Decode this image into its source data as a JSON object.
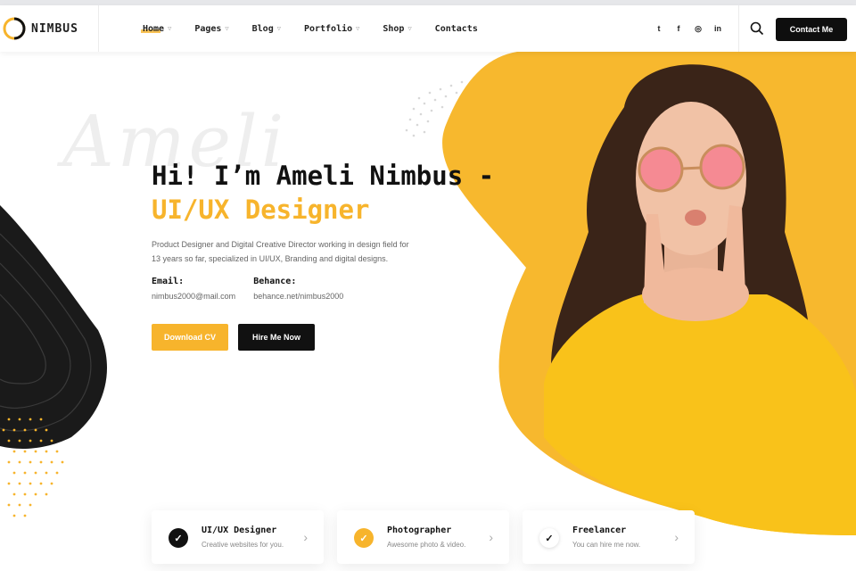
{
  "brand": {
    "name": "NIMBUS"
  },
  "nav": [
    {
      "label": "Home",
      "active": true
    },
    {
      "label": "Pages",
      "active": false
    },
    {
      "label": "Blog",
      "active": false
    },
    {
      "label": "Portfolio",
      "active": false
    },
    {
      "label": "Shop",
      "active": false
    },
    {
      "label": "Contacts",
      "active": false
    }
  ],
  "social": [
    {
      "icon": "twitter-icon",
      "glyph": "t"
    },
    {
      "icon": "facebook-icon",
      "glyph": "f"
    },
    {
      "icon": "instagram-icon",
      "glyph": "◎"
    },
    {
      "icon": "linkedin-icon",
      "glyph": "in"
    }
  ],
  "header": {
    "contact_label": "Contact Me"
  },
  "hero": {
    "watermark": "Ameli",
    "title_line1": "Hi! I’m Ameli Nimbus -",
    "title_line2": "UI/UX Designer",
    "description": "Product Designer and Digital Creative Director working in design field for 13 years so far, specialized in UI/UX, Branding and digital designs.",
    "email_label": "Email:",
    "email_value": "nimbus2000@mail.com",
    "behance_label": "Behance:",
    "behance_value": "behance.net/nimbus2000",
    "download_label": "Download CV",
    "hire_label": "Hire Me Now"
  },
  "services": [
    {
      "title": "UI/UX Designer",
      "subtitle": "Creative websites for you.",
      "icon_color": "#111111"
    },
    {
      "title": "Photographer",
      "subtitle": "Awesome photo & video.",
      "icon_color": "#f7b42c"
    },
    {
      "title": "Freelancer",
      "subtitle": "You can hire me now.",
      "icon_color": "#ffffff"
    }
  ],
  "colors": {
    "accent": "#f7b42c",
    "dark": "#111111"
  }
}
